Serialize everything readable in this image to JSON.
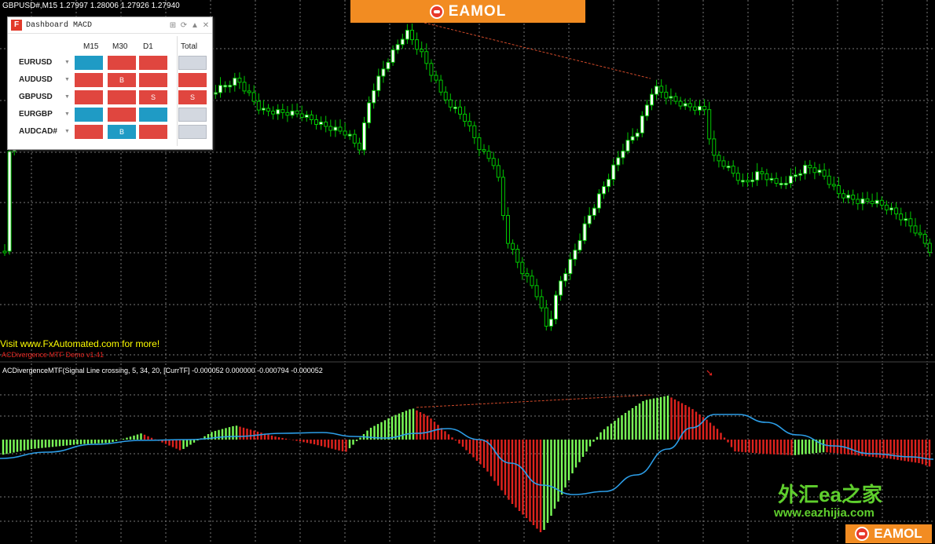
{
  "chart": {
    "symbol_line": "GBPUSD#,M15  1.27997 1.28006 1.27926 1.27940",
    "visit_text": "Visit www.FxAutomated.com for more!",
    "demo_text": "ACDivergence MTF  Demo v1.41",
    "indicator_line": "ACDivergenceMTF(Signal Line crossing, 5, 34, 20, [CurrTF] -0.000052 0.000000 -0.000794 -0.000052",
    "bull_color": "#00c800",
    "hist_up_color": "#7cff58",
    "hist_down_color": "#e0221d",
    "signal_color": "#2c9ee8",
    "divergence_color": "#d14a2a"
  },
  "branding": {
    "banner_text": "EAMOL",
    "watermark_cn": "外汇ea之家",
    "watermark_url": "www.eazhijia.com",
    "bottom_banner_text": "EAMOL"
  },
  "dashboard": {
    "title": "Dashboard MACD",
    "columns": [
      "M15",
      "M30",
      "D1"
    ],
    "total_label": "Total",
    "rows": [
      {
        "pair": "EURUSD",
        "cells": [
          {
            "color": "blue",
            "text": ""
          },
          {
            "color": "red",
            "text": ""
          },
          {
            "color": "red",
            "text": ""
          }
        ],
        "total": {
          "color": "grey",
          "text": ""
        }
      },
      {
        "pair": "AUDUSD",
        "cells": [
          {
            "color": "red",
            "text": ""
          },
          {
            "color": "red",
            "text": "B"
          },
          {
            "color": "red",
            "text": ""
          }
        ],
        "total": {
          "color": "red",
          "text": ""
        }
      },
      {
        "pair": "GBPUSD",
        "cells": [
          {
            "color": "red",
            "text": ""
          },
          {
            "color": "red",
            "text": ""
          },
          {
            "color": "red",
            "text": "S"
          }
        ],
        "total": {
          "color": "red",
          "text": "S"
        }
      },
      {
        "pair": "EURGBP",
        "cells": [
          {
            "color": "blue",
            "text": ""
          },
          {
            "color": "red",
            "text": ""
          },
          {
            "color": "blue",
            "text": ""
          }
        ],
        "total": {
          "color": "grey",
          "text": ""
        }
      },
      {
        "pair": "AUDCAD#",
        "cells": [
          {
            "color": "red",
            "text": ""
          },
          {
            "color": "blue",
            "text": "B"
          },
          {
            "color": "red",
            "text": ""
          }
        ],
        "total": {
          "color": "grey",
          "text": ""
        }
      }
    ]
  }
}
